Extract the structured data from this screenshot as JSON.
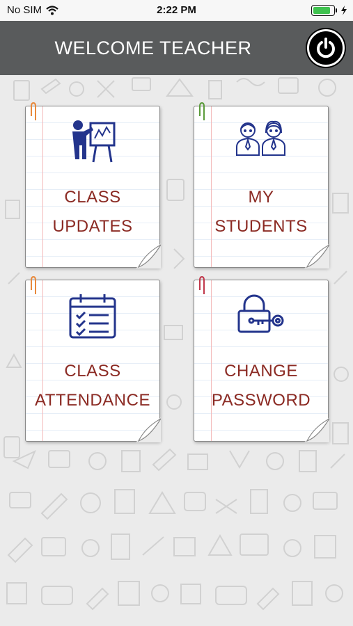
{
  "status_bar": {
    "carrier": "No SIM",
    "time": "2:22 PM",
    "battery_level": 0.85,
    "icons": [
      "wifi-icon",
      "battery-icon",
      "charging-icon"
    ]
  },
  "header": {
    "title": "WELCOME TEACHER",
    "background_color": "#595b5c",
    "logout_icon": "power-icon"
  },
  "cards": [
    {
      "line1": "CLASS",
      "line2": "UPDATES",
      "icon": "teacher-board-icon",
      "clip_color": "#e8893c"
    },
    {
      "line1": "MY",
      "line2": "STUDENTS",
      "icon": "students-icon",
      "clip_color": "#5a9b3a"
    },
    {
      "line1": "CLASS",
      "line2": "ATTENDANCE",
      "icon": "attendance-calendar-icon",
      "clip_color": "#e8893c"
    },
    {
      "line1": "CHANGE",
      "line2": "PASSWORD",
      "icon": "lock-key-icon",
      "clip_color": "#c0374a"
    }
  ],
  "colors": {
    "label_text": "#8b2a23",
    "icon_blue": "#23348c",
    "background": "#ebebeb"
  }
}
